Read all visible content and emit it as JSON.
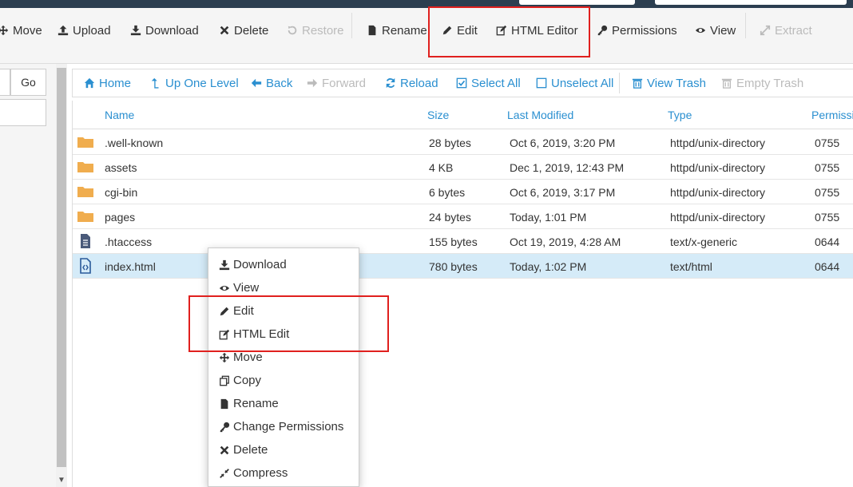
{
  "toolbar": {
    "move": "Move",
    "upload": "Upload",
    "download": "Download",
    "delete": "Delete",
    "restore": "Restore",
    "rename": "Rename",
    "edit": "Edit",
    "html_editor": "HTML Editor",
    "permissions": "Permissions",
    "view": "View",
    "extract": "Extract"
  },
  "left": {
    "go": "Go"
  },
  "nav": {
    "home": "Home",
    "up": "Up One Level",
    "back": "Back",
    "forward": "Forward",
    "reload": "Reload",
    "select_all": "Select All",
    "unselect_all": "Unselect All",
    "view_trash": "View Trash",
    "empty_trash": "Empty Trash"
  },
  "table": {
    "headers": {
      "name": "Name",
      "size": "Size",
      "modified": "Last Modified",
      "type": "Type",
      "perms": "Permissi"
    },
    "rows": [
      {
        "name": ".well-known",
        "size": "28 bytes",
        "modified": "Oct 6, 2019, 3:20 PM",
        "type": "httpd/unix-directory",
        "perms": "0755",
        "icon": "folder-icon"
      },
      {
        "name": "assets",
        "size": "4 KB",
        "modified": "Dec 1, 2019, 12:43 PM",
        "type": "httpd/unix-directory",
        "perms": "0755",
        "icon": "folder-icon"
      },
      {
        "name": "cgi-bin",
        "size": "6 bytes",
        "modified": "Oct 6, 2019, 3:17 PM",
        "type": "httpd/unix-directory",
        "perms": "0755",
        "icon": "folder-icon"
      },
      {
        "name": "pages",
        "size": "24 bytes",
        "modified": "Today, 1:01 PM",
        "type": "httpd/unix-directory",
        "perms": "0755",
        "icon": "folder-icon"
      },
      {
        "name": ".htaccess",
        "size": "155 bytes",
        "modified": "Oct 19, 2019, 4:28 AM",
        "type": "text/x-generic",
        "perms": "0644",
        "icon": "text-file-icon"
      },
      {
        "name": "index.html",
        "size": "780 bytes",
        "modified": "Today, 1:02 PM",
        "type": "text/html",
        "perms": "0644",
        "icon": "html-file-icon"
      }
    ]
  },
  "context_menu": {
    "download": "Download",
    "view": "View",
    "edit": "Edit",
    "html_edit": "HTML Edit",
    "move": "Move",
    "copy": "Copy",
    "rename": "Rename",
    "change_permissions": "Change Permissions",
    "delete": "Delete",
    "compress": "Compress"
  },
  "colors": {
    "link": "#2a8fd0",
    "highlight": "#e0201e",
    "folder": "#f0ad4e",
    "selected_row": "#d5ebf8"
  }
}
